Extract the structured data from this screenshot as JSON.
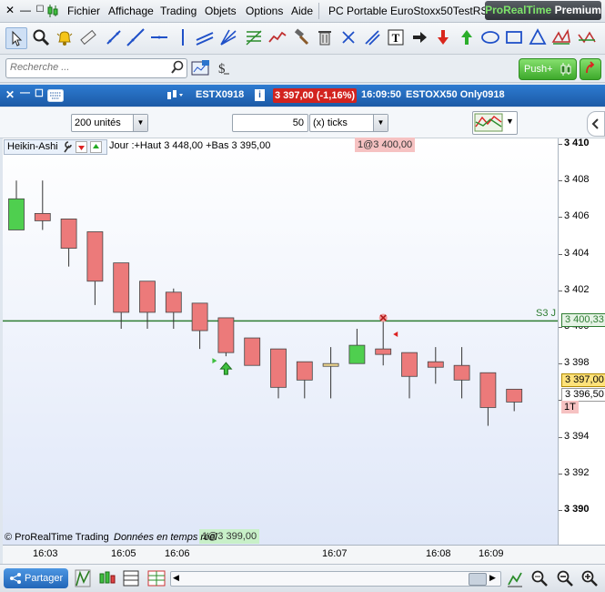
{
  "menubar": {
    "items": [
      "Fichier",
      "Affichage",
      "Trading",
      "Objets",
      "Options",
      "Aide"
    ],
    "platform_title": "PC Portable EuroStoxx50TestRSI",
    "brand_prefix": "ProRealTime",
    "brand_suffix": "Premium"
  },
  "search": {
    "placeholder": "Recherche ..."
  },
  "push_button": {
    "label": "Push+"
  },
  "titlebar": {
    "instrument": "ESTX0918",
    "price_change": "3 397,00 (-1,16%)",
    "time": "16:09:50",
    "description": "ESTOXX50 Only0918"
  },
  "controls": {
    "units": "200 unités",
    "ticks_value": "50",
    "ticks_unit": "(x) ticks"
  },
  "chart_header": {
    "chart_type": "Heikin-Ashi",
    "day_info": "Jour :+Haut 3 448,00 +Bas 3 395,00",
    "order_top": "1@3 400,00",
    "order_bottom": "1@3 399,00",
    "line_label": "S3 J",
    "copyright": "© ProRealTime Trading",
    "delay_note": "Données en temps réel"
  },
  "price_tags": {
    "line_price": "3 400,33",
    "last_price": "3 397,00",
    "bid_price": "3 396,50",
    "position": "1T"
  },
  "colors": {
    "bull": "#4fcf4f",
    "bear": "#ec7a7a",
    "line": "#2e7d32",
    "accent": "#1f63b5"
  },
  "chart_data": {
    "type": "candlestick",
    "y_ticks": [
      "3 410",
      "3 408",
      "3 406",
      "3 404",
      "3 402",
      "3 400",
      "3 398",
      "3 396",
      "3 394",
      "3 392",
      "3 390"
    ],
    "ylim": [
      3389.5,
      3410.5
    ],
    "x_ticks": [
      "16:03",
      "16:05",
      "16:06",
      "16:07",
      "16:08",
      "16:09"
    ],
    "horizontal_line": 3400.33,
    "candles": [
      {
        "o": 3405.3,
        "c": 3407.0,
        "h": 3408.0,
        "l": 3405.3
      },
      {
        "o": 3406.2,
        "c": 3405.8,
        "h": 3408.0,
        "l": 3405.3
      },
      {
        "o": 3405.9,
        "c": 3404.3,
        "h": 3405.9,
        "l": 3403.3
      },
      {
        "o": 3405.2,
        "c": 3402.5,
        "h": 3405.2,
        "l": 3401.2
      },
      {
        "o": 3403.5,
        "c": 3400.8,
        "h": 3403.5,
        "l": 3399.9
      },
      {
        "o": 3402.5,
        "c": 3400.8,
        "h": 3402.5,
        "l": 3399.9
      },
      {
        "o": 3401.9,
        "c": 3400.8,
        "h": 3402.1,
        "l": 3399.9
      },
      {
        "o": 3401.3,
        "c": 3399.8,
        "h": 3401.3,
        "l": 3398.8
      },
      {
        "o": 3400.5,
        "c": 3398.6,
        "h": 3400.5,
        "l": 3398.4
      },
      {
        "o": 3399.4,
        "c": 3397.9,
        "h": 3399.4,
        "l": 3397.9
      },
      {
        "o": 3398.8,
        "c": 3396.7,
        "h": 3398.8,
        "l": 3396.1
      },
      {
        "o": 3398.1,
        "c": 3397.1,
        "h": 3398.1,
        "l": 3396.1
      },
      {
        "o": 3398.0,
        "c": 3398.0,
        "h": 3398.9,
        "l": 3396.1
      },
      {
        "o": 3398.0,
        "c": 3399.0,
        "h": 3399.9,
        "l": 3398.0
      },
      {
        "o": 3398.8,
        "c": 3398.5,
        "h": 3400.5,
        "l": 3397.9
      },
      {
        "o": 3398.6,
        "c": 3397.3,
        "h": 3398.6,
        "l": 3396.1
      },
      {
        "o": 3398.1,
        "c": 3397.8,
        "h": 3398.9,
        "l": 3396.9
      },
      {
        "o": 3397.9,
        "c": 3397.1,
        "h": 3398.9,
        "l": 3396.1
      },
      {
        "o": 3397.5,
        "c": 3395.6,
        "h": 3397.5,
        "l": 3394.6
      },
      {
        "o": 3396.6,
        "c": 3395.9,
        "h": 3396.6,
        "l": 3395.4
      }
    ]
  }
}
